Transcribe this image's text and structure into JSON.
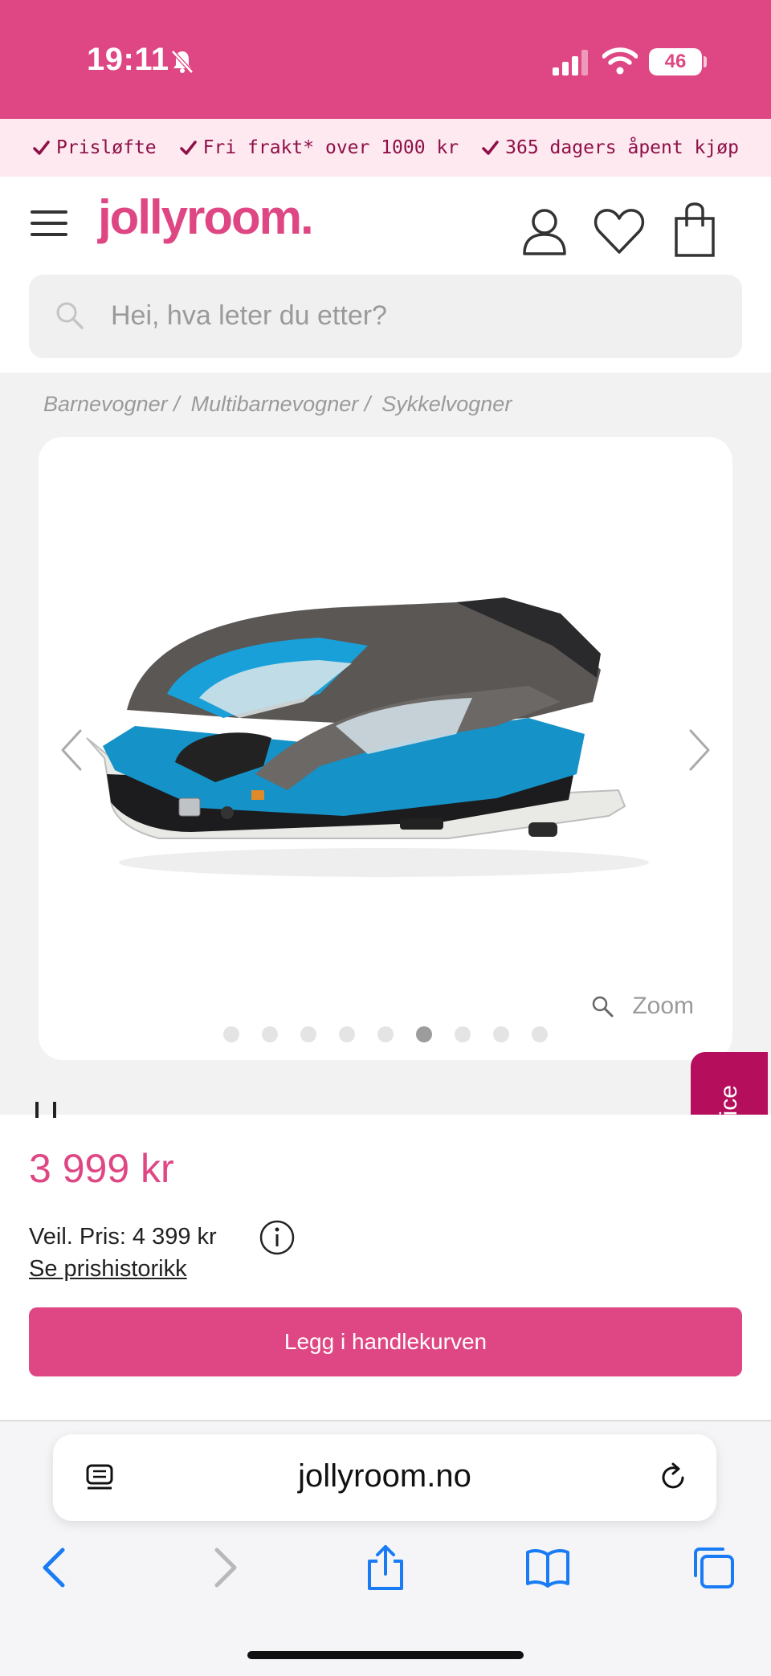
{
  "status_bar": {
    "time": "19:11",
    "battery": "46"
  },
  "usp_bar": {
    "items": [
      "Prisløfte",
      "Fri frakt* over 1000 kr",
      "365 dagers åpent kjøp"
    ]
  },
  "header": {
    "logo": "jollyroom.",
    "search_placeholder": "Hei, hva leter du etter?"
  },
  "breadcrumb": [
    "Barnevogner /",
    "Multibarnevogner /",
    "Sykkelvogner"
  ],
  "gallery": {
    "zoom_label": "Zoom",
    "image_count": 9,
    "active_image_index": 6
  },
  "side_tab": {
    "label": "Kundeservice"
  },
  "product": {
    "price": "3 999 kr",
    "recommended_price": "Veil. Pris: 4 399 kr",
    "price_history_link": "Se prishistorikk",
    "add_to_cart": "Legg i handlekurven"
  },
  "browser": {
    "url": "jollyroom.no"
  },
  "colors": {
    "brand_pink": "#de4783",
    "deep_magenta": "#b50e5c",
    "usp_text": "#8e0f48",
    "ios_blue": "#1a7cf5"
  }
}
